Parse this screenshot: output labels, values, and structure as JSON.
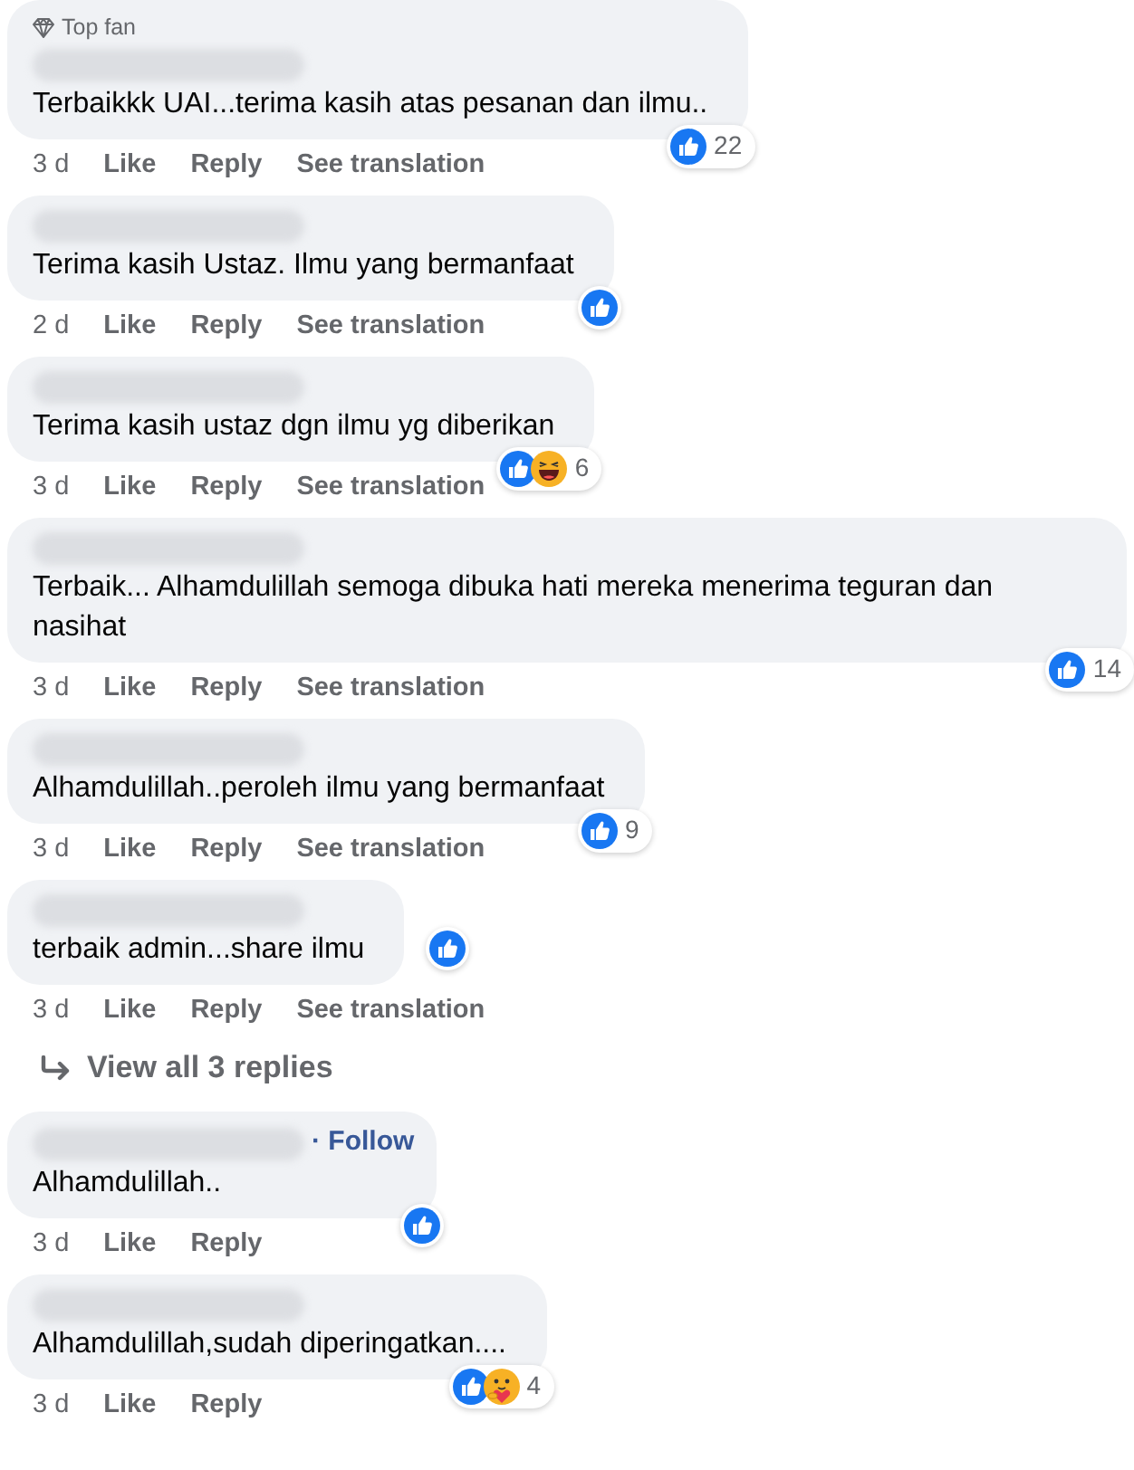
{
  "comments": [
    {
      "badge": "Top fan",
      "text": "Terbaikkk UAI...terima kasih atas pesanan dan ilmu..",
      "reactions": [
        {
          "kind": "like"
        }
      ],
      "count": "22",
      "time": "3 d",
      "actions": [
        "Like",
        "Reply",
        "See translation"
      ]
    },
    {
      "text": "Terima kasih Ustaz. Ilmu yang bermanfaat",
      "reactions": [
        {
          "kind": "like"
        }
      ],
      "time": "2 d",
      "actions": [
        "Like",
        "Reply",
        "See translation"
      ]
    },
    {
      "text": "Terima kasih ustaz dgn ilmu yg diberikan",
      "reactions": [
        {
          "kind": "like"
        },
        {
          "kind": "haha"
        }
      ],
      "count": "6",
      "time": "3 d",
      "actions": [
        "Like",
        "Reply",
        "See translation"
      ]
    },
    {
      "text": "Terbaik... Alhamdulillah semoga dibuka hati mereka menerima teguran dan nasihat",
      "reactions": [
        {
          "kind": "like"
        }
      ],
      "count": "14",
      "time": "3 d",
      "actions": [
        "Like",
        "Reply",
        "See translation"
      ]
    },
    {
      "text": "Alhamdulillah..peroleh ilmu yang bermanfaat",
      "reactions": [
        {
          "kind": "like"
        }
      ],
      "count": "9",
      "time": "3 d",
      "actions": [
        "Like",
        "Reply",
        "See translation"
      ]
    },
    {
      "text": "terbaik admin...share ilmu",
      "reactions": [
        {
          "kind": "like"
        }
      ],
      "time": "3 d",
      "actions": [
        "Like",
        "Reply",
        "See translation"
      ],
      "replies_link": "View all 3 replies"
    },
    {
      "follow": "· Follow",
      "text": "Alhamdulillah..",
      "reactions": [
        {
          "kind": "like"
        }
      ],
      "time": "3 d",
      "actions": [
        "Like",
        "Reply"
      ]
    },
    {
      "text": "Alhamdulillah,sudah diperingatkan....",
      "reactions": [
        {
          "kind": "like"
        },
        {
          "kind": "care"
        }
      ],
      "count": "4",
      "time": "3 d",
      "actions": [
        "Like",
        "Reply"
      ]
    }
  ]
}
